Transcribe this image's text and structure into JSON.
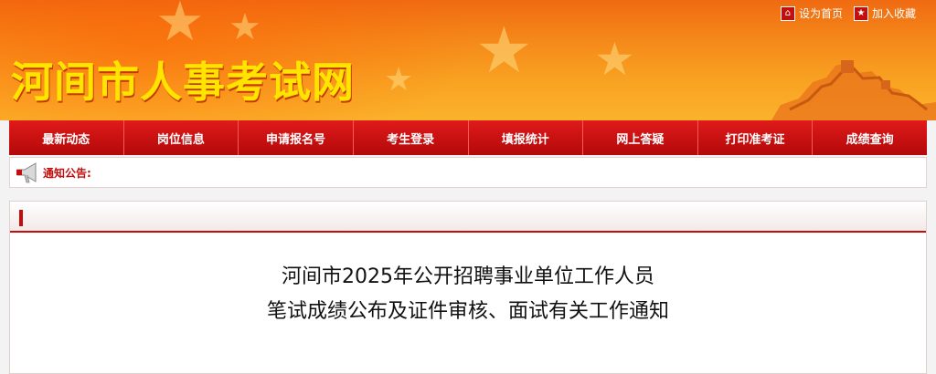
{
  "header": {
    "links": [
      {
        "label": "设为首页",
        "icon": "home-icon"
      },
      {
        "label": "加入收藏",
        "icon": "star-icon"
      }
    ],
    "site_title": "河间市人事考试网"
  },
  "nav": {
    "items": [
      "最新动态",
      "岗位信息",
      "申请报名号",
      "考生登录",
      "填报统计",
      "网上答疑",
      "打印准考证",
      "成绩查询"
    ]
  },
  "notice": {
    "icon": "megaphone-icon",
    "label": "通知公告:"
  },
  "article": {
    "title_line1": "河间市2025年公开招聘事业单位工作人员",
    "title_line2": "笔试成绩公布及证件审核、面试有关工作通知"
  },
  "colors": {
    "nav_red": "#c40d0d",
    "title_yellow": "#ffe400",
    "header_orange": "#f58a1a"
  }
}
